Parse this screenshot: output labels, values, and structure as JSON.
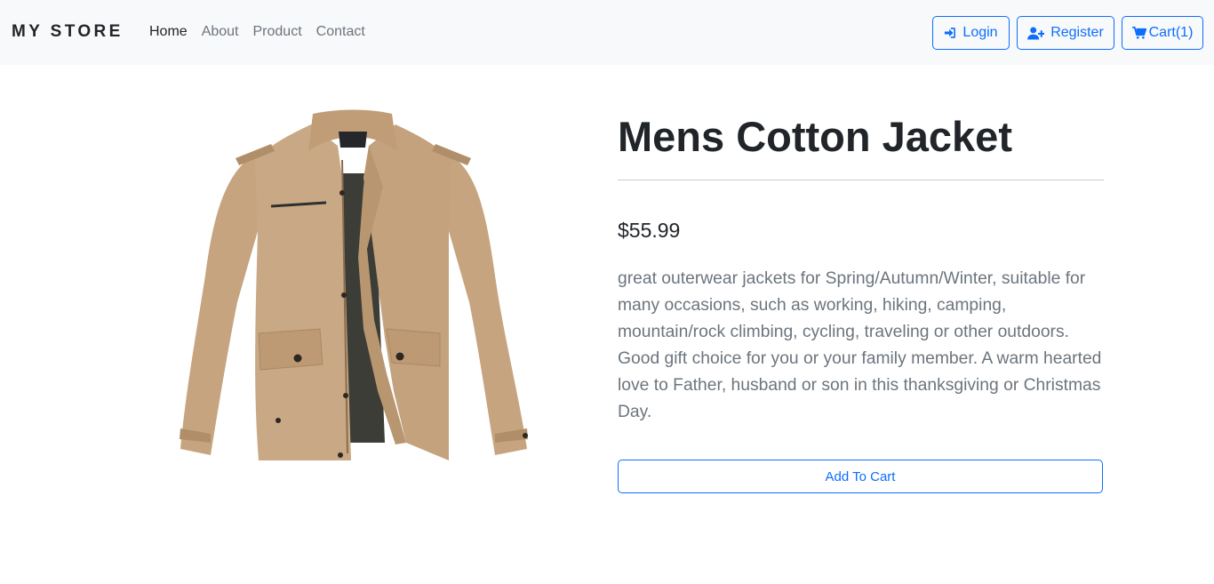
{
  "navbar": {
    "brand": "MY STORE",
    "links": [
      {
        "label": "Home",
        "active": true
      },
      {
        "label": "About"
      },
      {
        "label": "Product"
      },
      {
        "label": "Contact"
      }
    ],
    "login_label": "Login",
    "login_icon": "sign-in-icon",
    "register_label": "Register",
    "register_icon": "user-plus-icon",
    "cart_label": "Cart(1)",
    "cart_icon": "shopping-cart-icon"
  },
  "product": {
    "image_icon": "jacket-image",
    "title": "Mens Cotton Jacket",
    "price": "$55.99",
    "description": "great outerwear jackets for Spring/Autumn/Winter, suitable for many occasions, such as working, hiking, camping, mountain/rock climbing, cycling, traveling or other outdoors. Good gift choice for you or your family member. A warm hearted love to Father, husband or son in this thanksgiving or Christmas Day.",
    "add_to_cart_label": "Add To Cart"
  },
  "colors": {
    "accent": "#0d6efd",
    "navbar_bg": "#f8f9fa",
    "muted_text": "#6c757d",
    "jacket_khaki": "#c9a985",
    "jacket_lining": "#3b3d36"
  }
}
